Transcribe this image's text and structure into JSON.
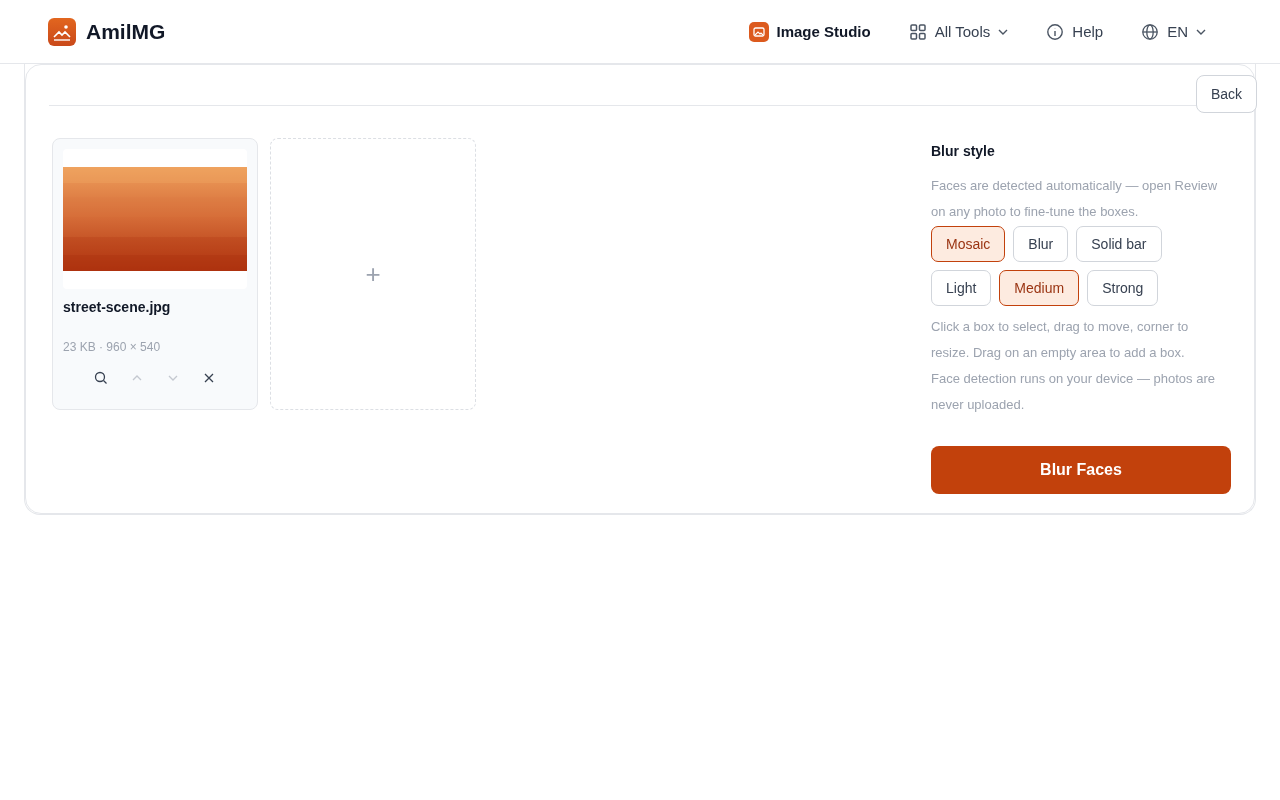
{
  "header": {
    "brand": "AmilMG",
    "nav": [
      {
        "kind": "studio",
        "label": "Image Studio",
        "dropdown": false
      },
      {
        "kind": "grid",
        "label": "All Tools",
        "dropdown": true
      },
      {
        "kind": "info",
        "label": "Help",
        "dropdown": false
      },
      {
        "kind": "globe",
        "label": "EN",
        "dropdown": true
      }
    ]
  },
  "back_button": "Back",
  "files": [
    {
      "name": "street-scene.jpg",
      "meta": "23 KB · 960 × 540",
      "actions": [
        {
          "kind": "zoom",
          "disabled": false
        },
        {
          "kind": "up",
          "disabled": true
        },
        {
          "kind": "down",
          "disabled": true
        },
        {
          "kind": "remove",
          "disabled": false
        }
      ]
    }
  ],
  "add_tile": {
    "label": "+"
  },
  "panel": {
    "title": "Blur style",
    "intro": "Faces are detected automatically — open Review on any photo to fine-tune the boxes.",
    "styles": [
      {
        "label": "Mosaic",
        "selected": true
      },
      {
        "label": "Blur",
        "selected": false
      },
      {
        "label": "Solid bar",
        "selected": false
      }
    ],
    "strengths": [
      {
        "label": "Light",
        "selected": false
      },
      {
        "label": "Medium",
        "selected": true
      },
      {
        "label": "Strong",
        "selected": false
      }
    ],
    "notes": [
      "Click a box to select, drag to move, corner to resize. Drag on an empty area to add a box.",
      "Face detection runs on your device — photos are never uploaded."
    ],
    "action": "Blur Faces"
  }
}
